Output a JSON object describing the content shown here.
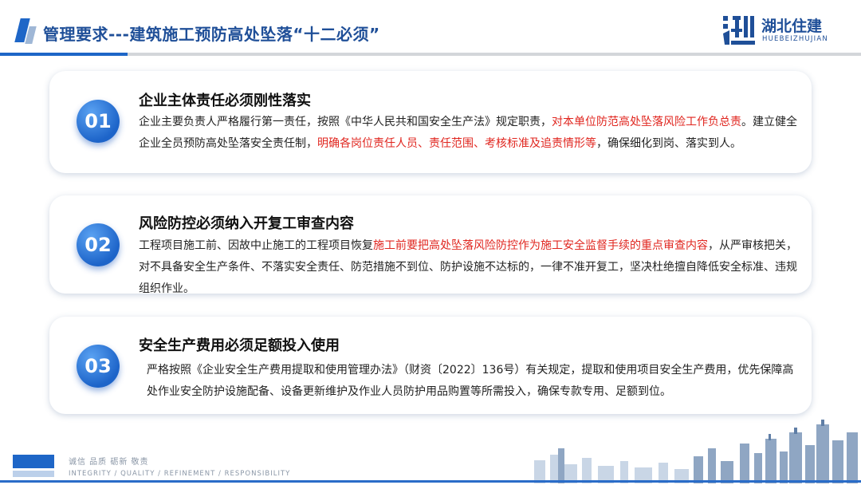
{
  "header": {
    "title": "管理要求---建筑施工预防高处坠落“十二必须”",
    "logo_cn": "湖北住建",
    "logo_en": "HUEBEIZHUJIAN"
  },
  "items": [
    {
      "number": "01",
      "title": "企业主体责任必须刚性落实",
      "body": [
        {
          "text": "企业主要负责人严格履行第一责任，按照《中华人民共和国安全生产法》规定职责，",
          "red": false
        },
        {
          "text": "对本单位防范高处坠落风险工作负总责",
          "red": true
        },
        {
          "text": "。建立健全企业全员预防高处坠落安全责任制，",
          "red": false
        },
        {
          "text": "明确各岗位责任人员、责任范围、考核标准及追责情形等",
          "red": true
        },
        {
          "text": "，确保细化到岗、落实到人。",
          "red": false
        }
      ]
    },
    {
      "number": "02",
      "title": "风险防控必须纳入开复工审查内容",
      "body": [
        {
          "text": "工程项目施工前、因故中止施工的工程项目恢复",
          "red": false
        },
        {
          "text": "施工前要把高处坠落风险防控作为施工安全监督手续的重点审查内容",
          "red": true
        },
        {
          "text": "，从严审核把关，对不具备安全生产条件、不落实安全责任、防范措施不到位、防护设施不达标的，一律不准开复工，坚决杜绝擅自降低安全标准、违规组织作业。",
          "red": false
        }
      ]
    },
    {
      "number": "03",
      "title": "安全生产费用必须足额投入使用",
      "body": [
        {
          "text": "严格按照《企业安全生产费用提取和使用管理办法》（财资〔2022〕136号）有关规定，提取和使用项目安全生产费用，优先保障高处作业安全防护设施配备、设备更新维护及作业人员防护用品购置等所需投入，确保专款专用、足额到位。",
          "red": false
        }
      ]
    }
  ],
  "footer": {
    "cn": "诚信 品质 砺新 敬责",
    "en": "INTEGRITY / QUALITY / REFINEMENT / RESPONSIBILITY"
  },
  "colors": {
    "accent": "#1e66c7",
    "title": "#1f4f98",
    "highlight": "#e0261f"
  }
}
